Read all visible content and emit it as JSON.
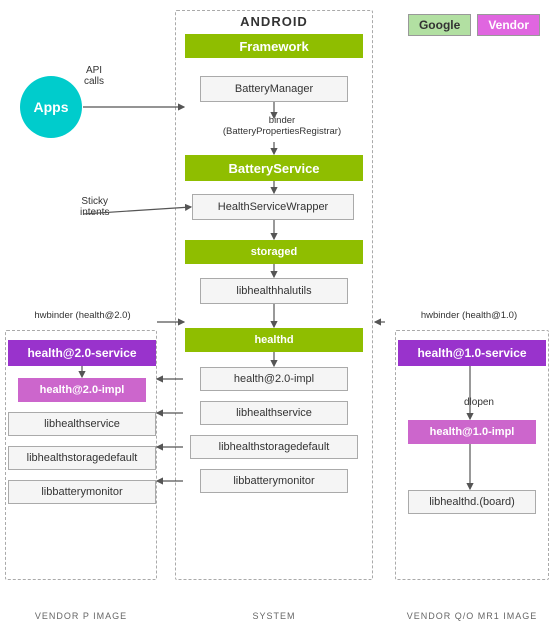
{
  "legend": {
    "google_label": "Google",
    "vendor_label": "Vendor"
  },
  "android_title": "ANDROID",
  "apps_label": "Apps",
  "api_calls_label": "API\ncalls",
  "sticky_intents_label": "Sticky\nintents",
  "framework_label": "Framework",
  "battery_manager_label": "BatteryManager",
  "binder_label": "binder\n(BatteryPropertiesRegistrar)",
  "battery_service_label": "BatteryService",
  "health_service_wrapper_label": "HealthServiceWrapper",
  "storaged_label": "storaged",
  "libhealthhalutils_label": "libhealthhalutils",
  "healthd_label": "healthd",
  "center_health_impl_label": "health@2.0-impl",
  "center_libhealthservice_label": "libhealthservice",
  "center_libhealthstoragedefault_label": "libhealthstoragedefault",
  "center_libbatterymonitor_label": "libbatterymonitor",
  "hwbinder_left_label": "hwbinder (health@2.0)",
  "hwbinder_right_label": "hwbinder (health@1.0)",
  "left_health_service_label": "health@2.0-service",
  "left_health_impl_label": "health@2.0-impl",
  "left_libhealthservice_label": "libhealthservice",
  "left_libhealthstoragedefault_label": "libhealthstoragedefault",
  "left_libbatterymonitor_label": "libbatterymonitor",
  "right_health_service_label": "health@1.0-service",
  "dlopen_label": "dlopen",
  "right_health_impl_label": "health@1.0-impl",
  "right_libhealthd_board_label": "libhealthd.(board)",
  "vendor_p_label": "VENDOR P IMAGE",
  "system_label": "SYSTEM",
  "vendor_q_label": "VENDOR Q/O MR1 IMAGE"
}
